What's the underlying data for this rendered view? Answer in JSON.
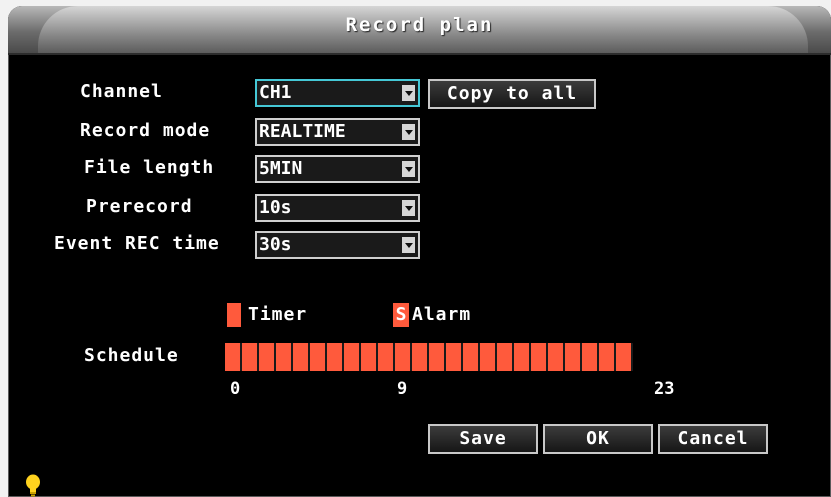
{
  "title": "Record plan",
  "form": {
    "channel_label": "Channel",
    "channel_value": "CH1",
    "copy_label": "Copy to all",
    "record_mode_label": "Record mode",
    "record_mode_value": "REALTIME",
    "file_length_label": "File length",
    "file_length_value": "5MIN",
    "prerecord_label": "Prerecord",
    "prerecord_value": "10s",
    "event_rec_label": "Event REC time",
    "event_rec_value": "30s"
  },
  "legend": {
    "timer_label": "Timer",
    "alarm_mark": "S",
    "alarm_label": "Alarm"
  },
  "schedule": {
    "label": "Schedule",
    "slot_count": 24,
    "tick_start": "0",
    "tick_mid": "9",
    "tick_end": "23"
  },
  "buttons": {
    "save": "Save",
    "ok": "OK",
    "cancel": "Cancel"
  },
  "colors": {
    "timer": "#ff5a3c",
    "focus_border": "#45c8d6"
  },
  "icons": {
    "hint": "lightbulb-icon"
  }
}
